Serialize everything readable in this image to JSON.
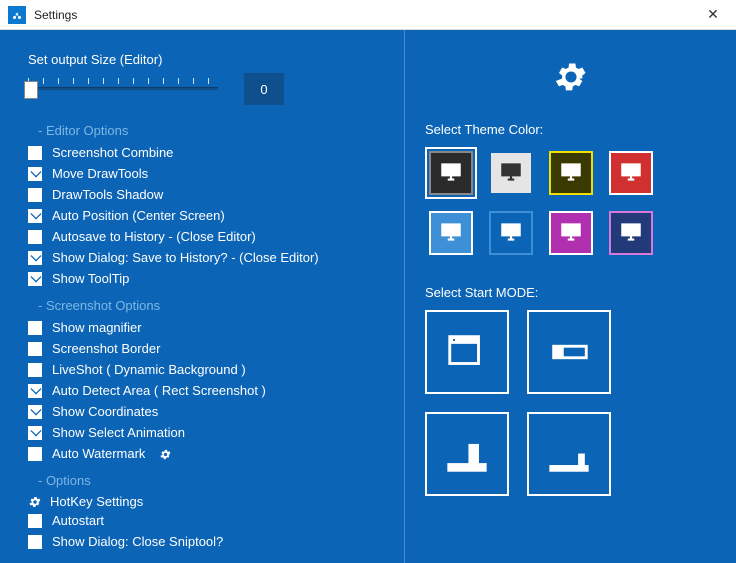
{
  "window": {
    "title": "Settings"
  },
  "left": {
    "output_label": "Set output Size (Editor)",
    "output_value": "0",
    "sections": {
      "editor_head": "- Editor Options",
      "screenshot_head": "- Screenshot Options",
      "options_head": "- Options"
    },
    "editor": [
      {
        "label": "Screenshot Combine",
        "checked": false
      },
      {
        "label": "Move DrawTools",
        "checked": true
      },
      {
        "label": "DrawTools Shadow",
        "checked": false
      },
      {
        "label": "Auto Position (Center Screen)",
        "checked": true
      },
      {
        "label": "Autosave to History - (Close Editor)",
        "checked": false
      },
      {
        "label": "Show Dialog: Save to History? - (Close Editor)",
        "checked": true
      },
      {
        "label": "Show ToolTip",
        "checked": true
      }
    ],
    "screenshot": [
      {
        "label": "Show magnifier",
        "checked": false
      },
      {
        "label": "Screenshot Border",
        "checked": false
      },
      {
        "label": "LiveShot ( Dynamic Background )",
        "checked": false
      },
      {
        "label": "Auto Detect Area ( Rect Screenshot )",
        "checked": true
      },
      {
        "label": "Show Coordinates",
        "checked": true
      },
      {
        "label": "Show Select Animation",
        "checked": true
      },
      {
        "label": "Auto Watermark",
        "checked": false,
        "gear": true
      }
    ],
    "options": {
      "hotkey": "HotKey Settings",
      "items": [
        {
          "label": "Autostart",
          "checked": false
        },
        {
          "label": "Show Dialog: Close Sniptool?",
          "checked": false
        }
      ]
    }
  },
  "right": {
    "theme_label": "Select Theme Color:",
    "start_label": "Select Start MODE:",
    "themes": [
      {
        "bg": "#2b2b2b",
        "border": "#888888",
        "selected": true
      },
      {
        "bg": "#e5e5e5",
        "border": "#0b64b5",
        "selected": false,
        "icon_dark": true
      },
      {
        "bg": "#3a3a00",
        "border": "#f0e000",
        "selected": false
      },
      {
        "bg": "#d03030",
        "border": "#ffffff",
        "selected": false
      },
      {
        "bg": "#3d8fd6",
        "border": "#ffffff",
        "selected": false
      },
      {
        "bg": "#0b64b5",
        "border": "#3d8fd6",
        "selected": false
      },
      {
        "bg": "#b030b0",
        "border": "#ffffff",
        "selected": false
      },
      {
        "bg": "#223a7a",
        "border": "#d878d8",
        "selected": false
      }
    ],
    "start_modes": [
      "window",
      "bar",
      "taskbar",
      "tray"
    ]
  }
}
